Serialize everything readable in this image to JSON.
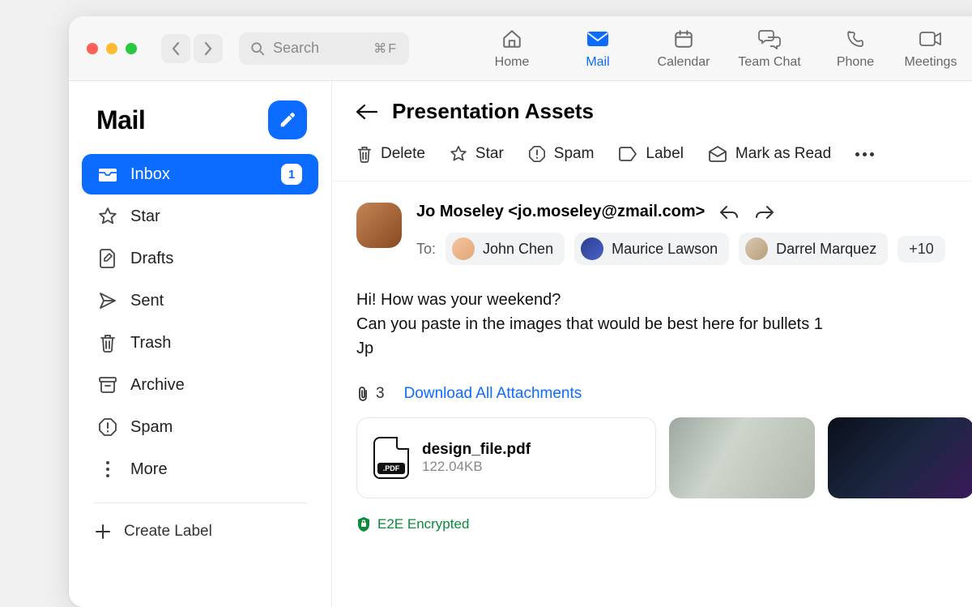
{
  "titlebar": {
    "search_placeholder": "Search",
    "search_kbd": "⌘F",
    "tabs": [
      {
        "label": "Home"
      },
      {
        "label": "Mail"
      },
      {
        "label": "Calendar"
      },
      {
        "label": "Team Chat"
      },
      {
        "label": "Phone"
      },
      {
        "label": "Meetings"
      }
    ]
  },
  "sidebar": {
    "title": "Mail",
    "create_label": "Create Label",
    "folders": [
      {
        "label": "Inbox",
        "badge": "1"
      },
      {
        "label": "Star"
      },
      {
        "label": "Drafts"
      },
      {
        "label": "Sent"
      },
      {
        "label": "Trash"
      },
      {
        "label": "Archive"
      },
      {
        "label": "Spam"
      },
      {
        "label": "More"
      }
    ]
  },
  "thread": {
    "subject": "Presentation Assets",
    "toolbar": {
      "delete": "Delete",
      "star": "Star",
      "spam": "Spam",
      "label": "Label",
      "mark_read": "Mark as Read"
    },
    "sender": {
      "name_line": "Jo Moseley <jo.moseley@zmail.com>",
      "to_label": "To:",
      "recipients": [
        {
          "name": "John Chen"
        },
        {
          "name": "Maurice Lawson"
        },
        {
          "name": "Darrel Marquez"
        }
      ],
      "overflow": "+10"
    },
    "body_line1": "Hi! How was your weekend?",
    "body_line2": "Can you paste in the images that would be best here for bullets 1",
    "body_line3": "Jp",
    "attachments": {
      "count": "3",
      "download_all": "Download All Attachments",
      "file": {
        "name": "design_file.pdf",
        "size": "122.04KB",
        "badge": ".PDF"
      }
    },
    "e2e": "E2E Encrypted"
  }
}
